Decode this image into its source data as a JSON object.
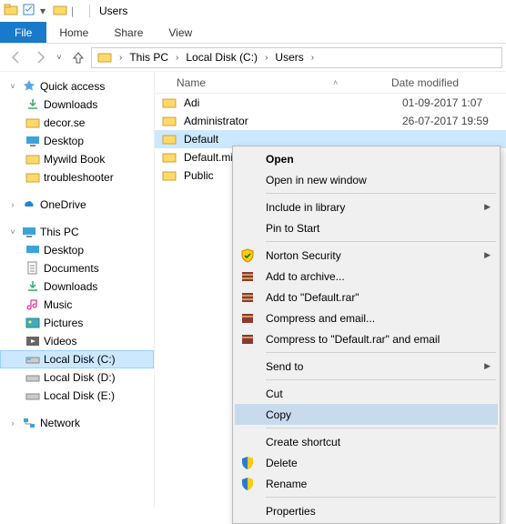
{
  "title": "Users",
  "ribbon": {
    "file": "File",
    "tabs": [
      "Home",
      "Share",
      "View"
    ]
  },
  "breadcrumb": [
    "This PC",
    "Local Disk (C:)",
    "Users"
  ],
  "sidebar": {
    "quick_access": "Quick access",
    "qa_items": [
      "Downloads",
      "decor.se",
      "Desktop",
      "Mywild Book",
      "troubleshooter"
    ],
    "onedrive": "OneDrive",
    "thispc": "This PC",
    "pc_items": [
      "Desktop",
      "Documents",
      "Downloads",
      "Music",
      "Pictures",
      "Videos"
    ],
    "drives": [
      "Local Disk (C:)",
      "Local Disk (D:)",
      "Local Disk (E:)"
    ],
    "network": "Network"
  },
  "columns": {
    "name": "Name",
    "date": "Date modified"
  },
  "rows": [
    {
      "name": "Adi",
      "date": "01-09-2017 1:07"
    },
    {
      "name": "Administrator",
      "date": "26-07-2017 19:59"
    },
    {
      "name": "Default",
      "selected": true
    },
    {
      "name": "Default.mi"
    },
    {
      "name": "Public"
    }
  ],
  "ctx": {
    "open": "Open",
    "open_new": "Open in new window",
    "include": "Include in library",
    "pin": "Pin to Start",
    "norton": "Norton Security",
    "add_archive": "Add to archive...",
    "add_rar": "Add to \"Default.rar\"",
    "compress_email": "Compress and email...",
    "compress_rar_email": "Compress to \"Default.rar\" and email",
    "sendto": "Send to",
    "cut": "Cut",
    "copy": "Copy",
    "shortcut": "Create shortcut",
    "delete": "Delete",
    "rename": "Rename",
    "properties": "Properties"
  }
}
